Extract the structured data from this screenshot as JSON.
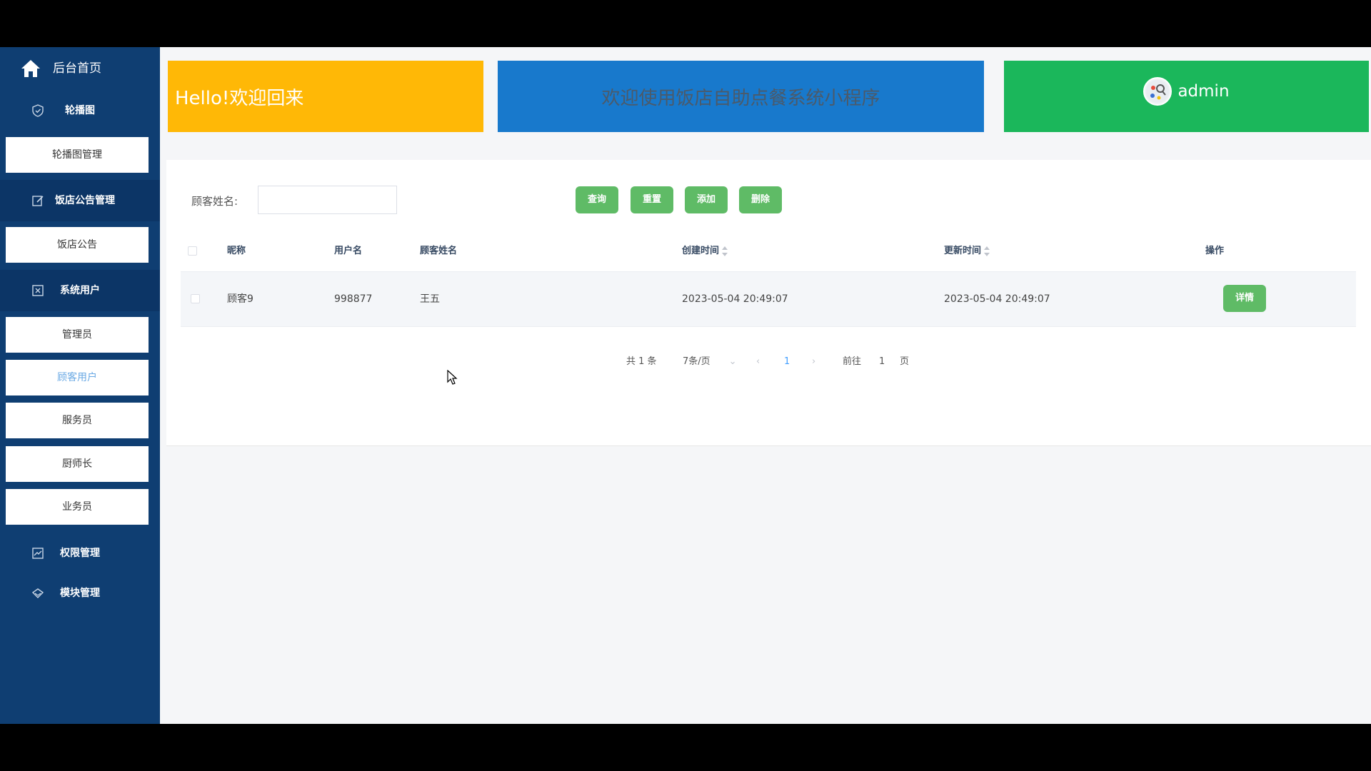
{
  "sidebar": {
    "home_label": "后台首页",
    "sections": [
      {
        "label": "轮播图",
        "icon": "shield-icon"
      },
      {
        "label": "饭店公告管理",
        "icon": "edit-icon"
      },
      {
        "label": "系统用户",
        "icon": "user-card-icon"
      },
      {
        "label": "权限管理",
        "icon": "chart-icon"
      },
      {
        "label": "模块管理",
        "icon": "diamond-icon"
      }
    ],
    "items": [
      "轮播图管理",
      "饭店公告",
      "管理员",
      "顾客用户",
      "服务员",
      "厨师长",
      "业务员"
    ]
  },
  "banners": {
    "welcome": "Hello!欢迎回来",
    "system_title": "欢迎使用饭店自助点餐系统小程序",
    "user": "admin"
  },
  "search": {
    "label": "顾客姓名:",
    "placeholder": ""
  },
  "actions": {
    "query": "查询",
    "reset": "重置",
    "add": "添加",
    "delete": "删除"
  },
  "table": {
    "columns": [
      "昵称",
      "用户名",
      "顾客姓名",
      "创建时间",
      "更新时间",
      "操作"
    ],
    "rows": [
      {
        "nickname": "顾客9",
        "username": "998877",
        "name": "王五",
        "created": "2023-05-04 20:49:07",
        "updated": "2023-05-04 20:49:07",
        "action": "详情"
      }
    ]
  },
  "pagination": {
    "total": "共 1 条",
    "page_size": "7条/页",
    "current": "1",
    "goto_prefix": "前往",
    "goto_value": "1",
    "goto_suffix": "页"
  },
  "colors": {
    "sidebar": "#0f3e72",
    "yellow_banner": "#ffb806",
    "blue_banner": "#1879cc",
    "green_banner": "#1bb75b",
    "button_green": "#5fbb66",
    "active_item": "#6aa9e4"
  }
}
